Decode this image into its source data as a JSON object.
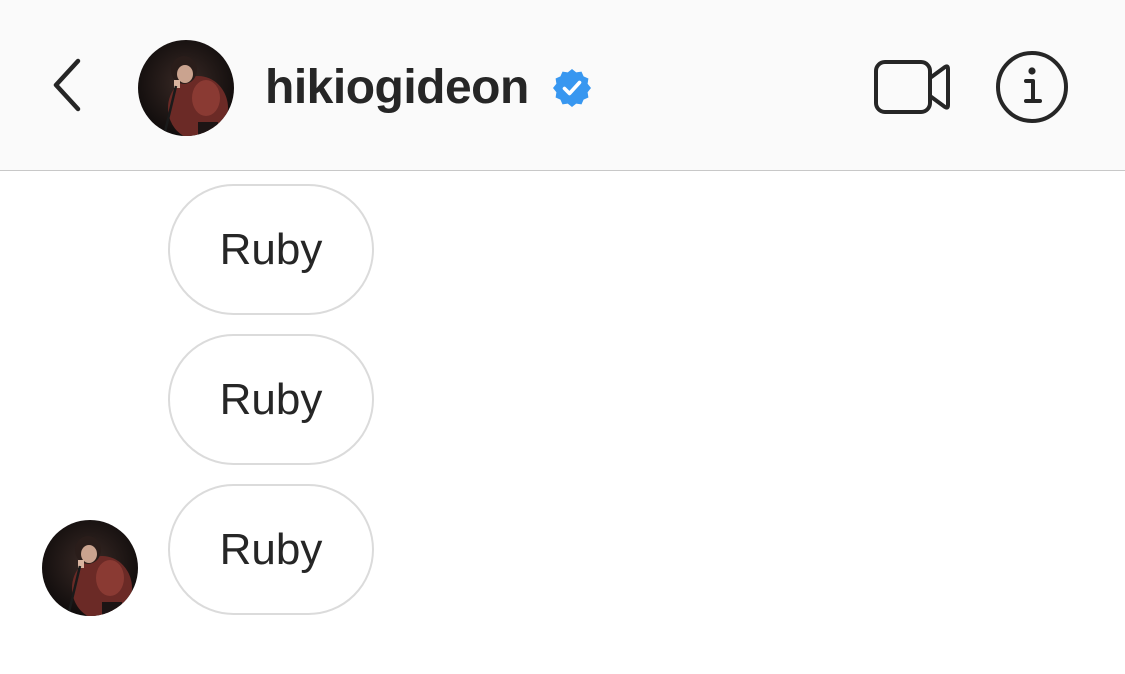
{
  "header": {
    "username": "hikiogideon",
    "verified": true,
    "back_icon": "chevron-left-icon",
    "video_icon": "video-camera-icon",
    "info_icon": "info-icon",
    "verified_color": "#3897f0",
    "background": "#fafafa"
  },
  "messages": [
    {
      "text": "Ruby"
    },
    {
      "text": "Ruby"
    },
    {
      "text": "Ruby"
    }
  ],
  "colors": {
    "text": "#262626",
    "bubble_border": "#dbdbdb",
    "divider": "#c8c8c8"
  }
}
